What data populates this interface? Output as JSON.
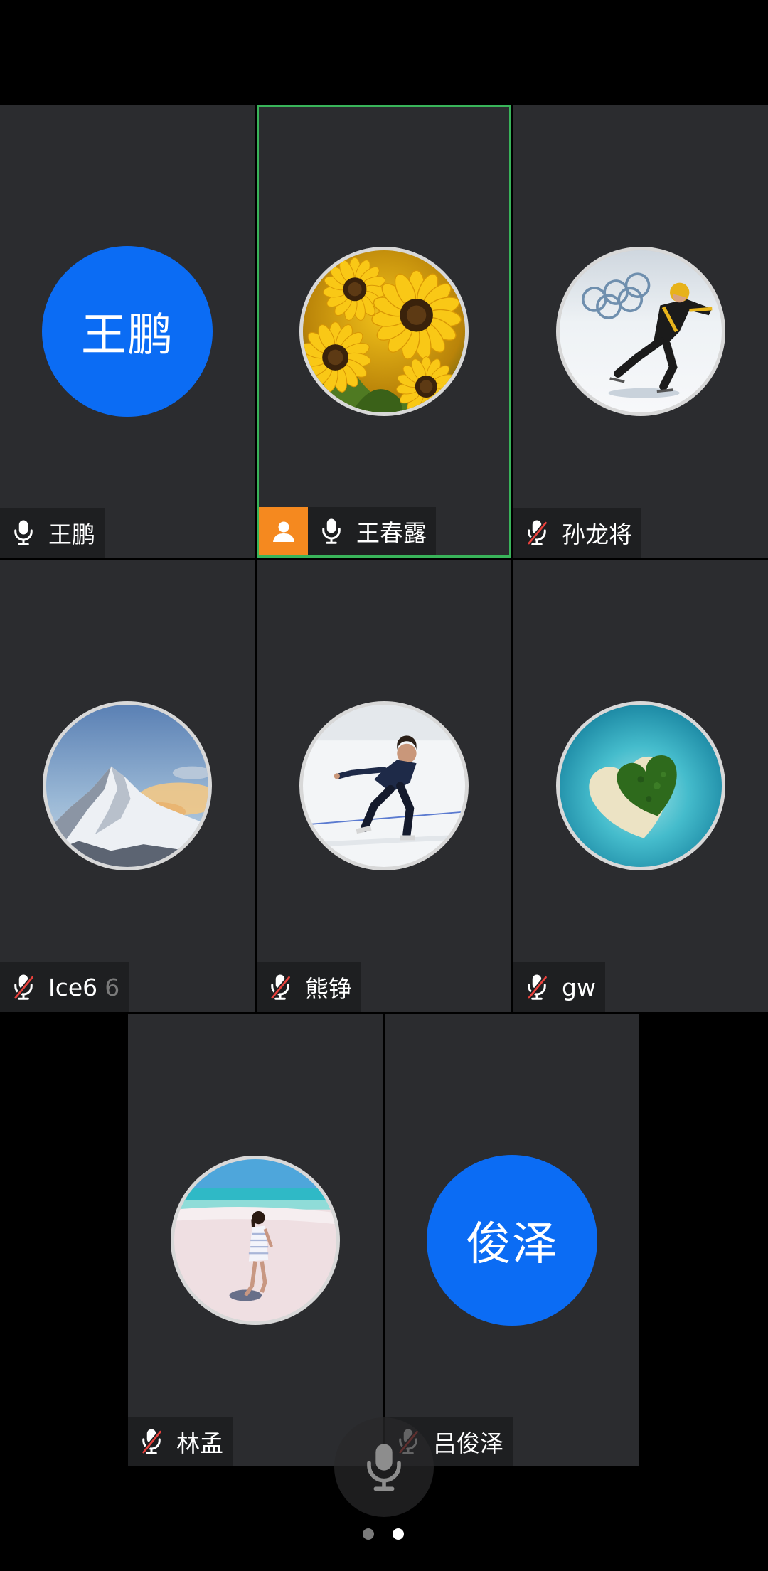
{
  "colors": {
    "background": "#000000",
    "tile": "#2b2c2f",
    "label": "#1e1f21",
    "avatar_blue": "#0b6cf4",
    "selected_border": "#39b45a",
    "badge": "#f5891f",
    "muted_slash": "#e8413c",
    "dot_inactive": "#7a7a7a",
    "dot_active": "#ffffff"
  },
  "participants": [
    {
      "name": "王鹏",
      "muted": false,
      "avatar_text": "王鹏"
    },
    {
      "name": "王春露",
      "muted": false,
      "selected": true,
      "badge_icon": "person-icon",
      "avatar_image": "sunflower-photo"
    },
    {
      "name": "孙龙将",
      "muted": true,
      "avatar_image": "speed-skater-photo"
    },
    {
      "name": "Ice6",
      "name_overflow": "6",
      "muted": true,
      "avatar_image": "mountain-photo"
    },
    {
      "name": "熊铮",
      "muted": true,
      "avatar_image": "skater-photo"
    },
    {
      "name": "gw",
      "muted": true,
      "avatar_image": "heart-island-photo"
    },
    {
      "name": "林孟",
      "muted": true,
      "avatar_image": "beach-photo"
    },
    {
      "name": "吕俊泽",
      "muted": true,
      "avatar_text": "俊泽"
    }
  ],
  "mic_button": {
    "icon": "microphone-icon"
  },
  "pager": {
    "pages": 2,
    "current": 2
  }
}
